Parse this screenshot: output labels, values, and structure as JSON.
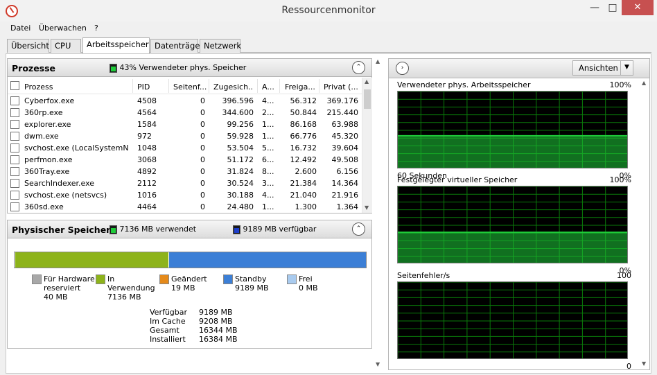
{
  "window": {
    "title": "Ressourcenmonitor",
    "minimize": "—",
    "maximize": "□",
    "close": "✕"
  },
  "menu": [
    "Datei",
    "Überwachen",
    "?"
  ],
  "tabs": [
    "Übersicht",
    "CPU",
    "Arbeitsspeicher",
    "Datenträger",
    "Netzwerk"
  ],
  "active_tab": "Arbeitsspeicher",
  "processes": {
    "title": "Prozesse",
    "summary": "43% Verwendeter phys. Speicher",
    "columns": [
      "Prozess",
      "PID",
      "Seitenf...",
      "Zugesich...",
      "A...",
      "Freiga...",
      "Privat (..."
    ],
    "rows": [
      [
        "Cyberfox.exe",
        "4508",
        "0",
        "396.596",
        "4...",
        "56.312",
        "369.176"
      ],
      [
        "360rp.exe",
        "4564",
        "0",
        "344.600",
        "2...",
        "50.844",
        "215.440"
      ],
      [
        "explorer.exe",
        "1584",
        "0",
        "99.256",
        "1...",
        "86.168",
        "63.988"
      ],
      [
        "dwm.exe",
        "972",
        "0",
        "59.928",
        "1...",
        "66.776",
        "45.320"
      ],
      [
        "svchost.exe (LocalSystemNet...",
        "1048",
        "0",
        "53.504",
        "5...",
        "16.732",
        "39.604"
      ],
      [
        "perfmon.exe",
        "3068",
        "0",
        "51.172",
        "6...",
        "12.492",
        "49.508"
      ],
      [
        "360Tray.exe",
        "4892",
        "0",
        "31.824",
        "8...",
        "2.600",
        "6.156"
      ],
      [
        "SearchIndexer.exe",
        "2112",
        "0",
        "30.524",
        "3...",
        "21.384",
        "14.364"
      ],
      [
        "svchost.exe (netsvcs)",
        "1016",
        "0",
        "30.188",
        "4...",
        "21.040",
        "21.916"
      ],
      [
        "360sd.exe",
        "4464",
        "0",
        "24.480",
        "1...",
        "1.300",
        "1.364"
      ]
    ]
  },
  "physical": {
    "title": "Physischer Speicher",
    "in_use_label": "7136 MB verwendet",
    "available_label": "9189 MB verfügbar",
    "bar": {
      "hardware_mb": 40,
      "in_use_mb": 7136,
      "modified_mb": 19,
      "standby_mb": 9189,
      "free_mb": 0,
      "total_mb": 16384
    },
    "legend": [
      {
        "line1": "Für Hardware",
        "line2": "reserviert",
        "value": "40 MB",
        "color": "#a8a8a8"
      },
      {
        "line1": "In",
        "line2": "Verwendung",
        "value": "7136 MB",
        "color": "#8db31b"
      },
      {
        "line1": "Geändert",
        "line2": "",
        "value": "19 MB",
        "color": "#e58a1a"
      },
      {
        "line1": "Standby",
        "line2": "",
        "value": "9189 MB",
        "color": "#3c7fd6"
      },
      {
        "line1": "Frei",
        "line2": "",
        "value": "0 MB",
        "color": "#a9cbef"
      }
    ],
    "stats": [
      {
        "label": "Verfügbar",
        "value": "9189 MB"
      },
      {
        "label": "Im Cache",
        "value": "9208 MB"
      },
      {
        "label": "Gesamt",
        "value": "16344 MB"
      },
      {
        "label": "Installiert",
        "value": "16384 MB"
      }
    ]
  },
  "views_button": "Ansichten",
  "graphs": [
    {
      "title": "Verwendeter phys. Arbeitsspeicher",
      "max": "100%",
      "sub": "60 Sekunden",
      "min": "0%",
      "level_percent": 43
    },
    {
      "title": "Festgelegter virtueller Speicher",
      "max": "100%",
      "sub": "",
      "min": "0%",
      "level_percent": 41
    },
    {
      "title": "Seitenfehler/s",
      "max": "100",
      "sub": "",
      "min": "0",
      "level_percent": 0
    }
  ],
  "colors": {
    "graph_line": "#1fcc3a",
    "graph_grid": "#0a7a0a",
    "close_button": "#c75050"
  }
}
